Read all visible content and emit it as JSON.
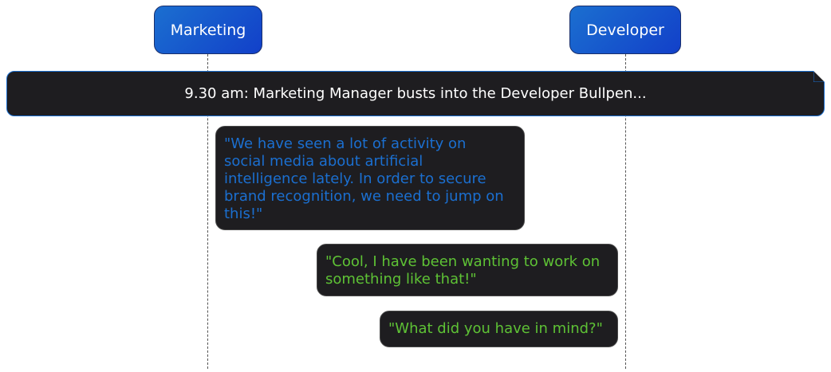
{
  "diagram": {
    "participants": [
      {
        "id": "marketing",
        "label": "Marketing"
      },
      {
        "id": "developer",
        "label": "Developer"
      }
    ],
    "note": {
      "text": "9.30 am: Marketing Manager busts into the Developer Bullpen..."
    },
    "messages": [
      {
        "speaker": "Marketing",
        "text": "\"We have seen a lot of activity on\nsocial media about artificial\nintelligence lately. In order to secure\nbrand recognition, we need to jump on\nthis!\""
      },
      {
        "speaker": "Developer",
        "text": "\"Cool, I have been wanting to work on\nsomething like that!\""
      },
      {
        "speaker": "Developer",
        "text": "\"What did you have in mind?\""
      }
    ],
    "colors": {
      "participant_fill": "#1b6fd0",
      "note_fill": "#1e1d20",
      "marketing_text": "#1b6fd0",
      "developer_text": "#5ec235"
    }
  }
}
